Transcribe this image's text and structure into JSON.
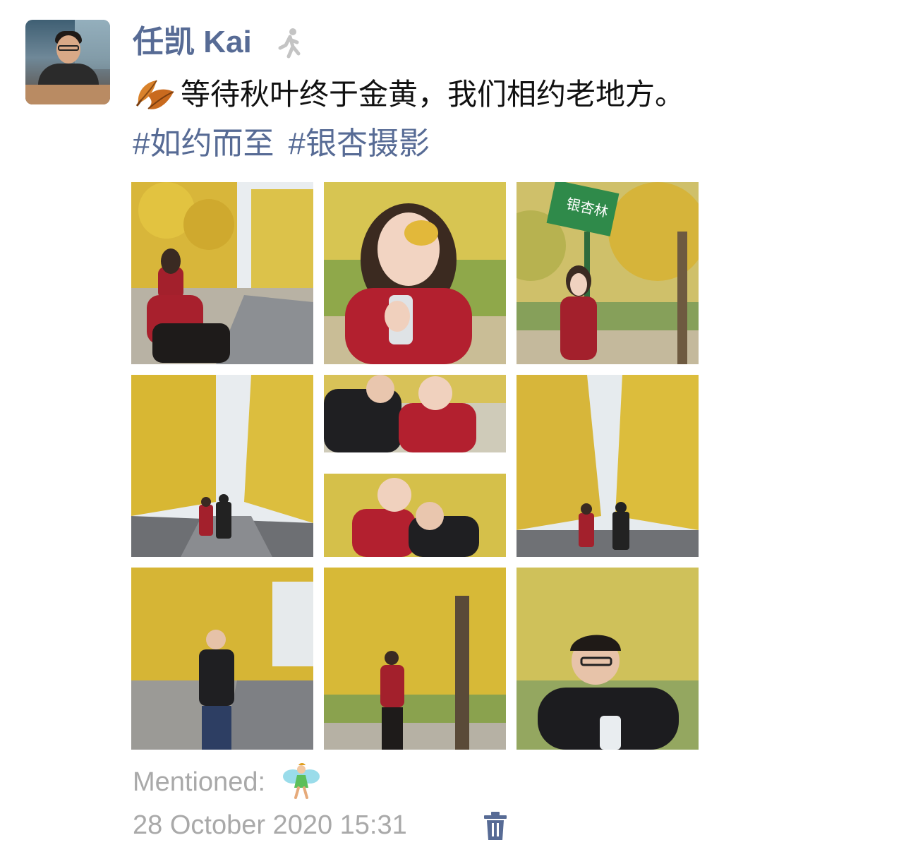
{
  "post": {
    "author_name": "任凯 Kai",
    "text": "等待秋叶终于金黄，我们相约老地方。",
    "tags": [
      "#如约而至",
      "#银杏摄影"
    ],
    "mentioned_label": "Mentioned:",
    "timestamp": "28 October 2020 15:31"
  },
  "colors": {
    "link": "#576b95",
    "meta": "#a9a9a9",
    "text": "#111111"
  },
  "icons": {
    "status": "walking-person-icon",
    "leaf": "maple-leaves-icon",
    "mention": "fairy-icon",
    "delete": "trash-icon"
  },
  "photos": [
    "photo-girl-sitting-ginkgo-road",
    "photo-girl-holding-leaf",
    "photo-girl-by-road-sign",
    "photo-couple-ginkgo-avenue",
    "photo-couple-collage",
    "photo-couple-holding-hands",
    "photo-man-on-road",
    "photo-girl-under-tree",
    "photo-man-closeup"
  ],
  "sign_text": "银杏林"
}
